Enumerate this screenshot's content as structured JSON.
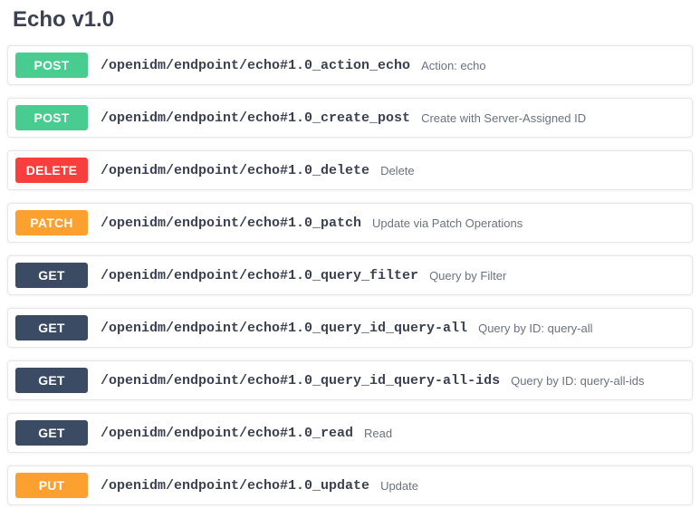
{
  "section": {
    "title": "Echo v1.0"
  },
  "operations": [
    {
      "method": "POST",
      "methodClass": "post",
      "path": "/openidm/endpoint/echo#1.0_action_echo",
      "desc": "Action: echo"
    },
    {
      "method": "POST",
      "methodClass": "post",
      "path": "/openidm/endpoint/echo#1.0_create_post",
      "desc": "Create with Server-Assigned ID"
    },
    {
      "method": "DELETE",
      "methodClass": "delete",
      "path": "/openidm/endpoint/echo#1.0_delete",
      "desc": "Delete"
    },
    {
      "method": "PATCH",
      "methodClass": "patch",
      "path": "/openidm/endpoint/echo#1.0_patch",
      "desc": "Update via Patch Operations"
    },
    {
      "method": "GET",
      "methodClass": "get",
      "path": "/openidm/endpoint/echo#1.0_query_filter",
      "desc": "Query by Filter"
    },
    {
      "method": "GET",
      "methodClass": "get",
      "path": "/openidm/endpoint/echo#1.0_query_id_query-all",
      "desc": "Query by ID: query-all"
    },
    {
      "method": "GET",
      "methodClass": "get",
      "path": "/openidm/endpoint/echo#1.0_query_id_query-all-ids",
      "desc": "Query by ID: query-all-ids"
    },
    {
      "method": "GET",
      "methodClass": "get",
      "path": "/openidm/endpoint/echo#1.0_read",
      "desc": "Read"
    },
    {
      "method": "PUT",
      "methodClass": "put",
      "path": "/openidm/endpoint/echo#1.0_update",
      "desc": "Update"
    }
  ]
}
